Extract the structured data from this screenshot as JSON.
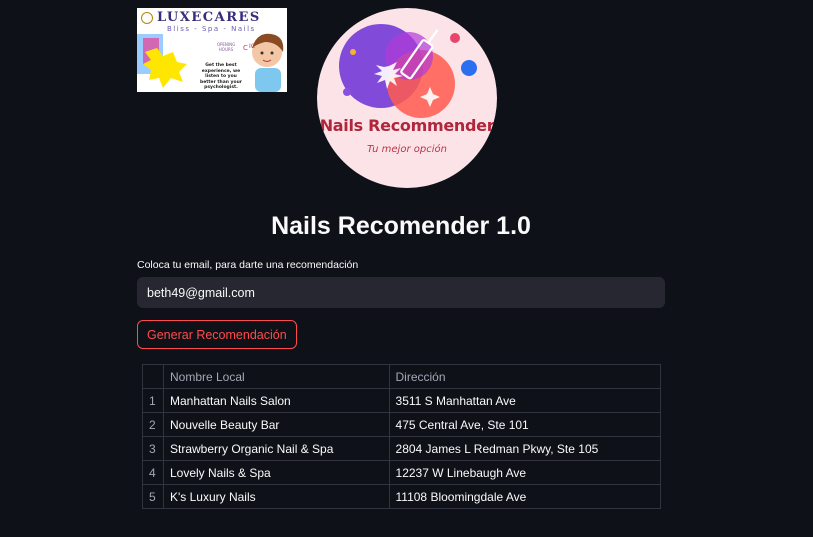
{
  "banner": {
    "brand": "LUXECARES",
    "brand_sub": "Bliss - Spa - Nails",
    "hours": "OPENING HOURS",
    "tagline": "Get the best experience, we listen to you better than your psychologist."
  },
  "logo": {
    "title": "Nails Recommender",
    "tagline": "Tu mejor opción"
  },
  "page": {
    "title": "Nails Recomender 1.0"
  },
  "form": {
    "label": "Coloca tu email, para darte una recomendación",
    "email_value": "beth49@gmail.com",
    "button_label": "Generar Recomendación"
  },
  "table": {
    "headers": [
      "",
      "Nombre Local",
      "Dirección"
    ],
    "rows": [
      {
        "index": "1",
        "name": "Manhattan Nails Salon",
        "address": "3511 S Manhattan Ave"
      },
      {
        "index": "2",
        "name": "Nouvelle Beauty Bar",
        "address": "475 Central Ave, Ste 101"
      },
      {
        "index": "3",
        "name": "Strawberry Organic Nail & Spa",
        "address": "2804 James L Redman Pkwy, Ste 105"
      },
      {
        "index": "4",
        "name": "Lovely Nails & Spa",
        "address": "12237 W Linebaugh Ave"
      },
      {
        "index": "5",
        "name": "K's Luxury Nails",
        "address": "11108 Bloomingdale Ave"
      }
    ]
  },
  "colors": {
    "background": "#0e1117",
    "input_bg": "#262730",
    "accent": "#ff4b4b",
    "table_border": "#31333f"
  }
}
